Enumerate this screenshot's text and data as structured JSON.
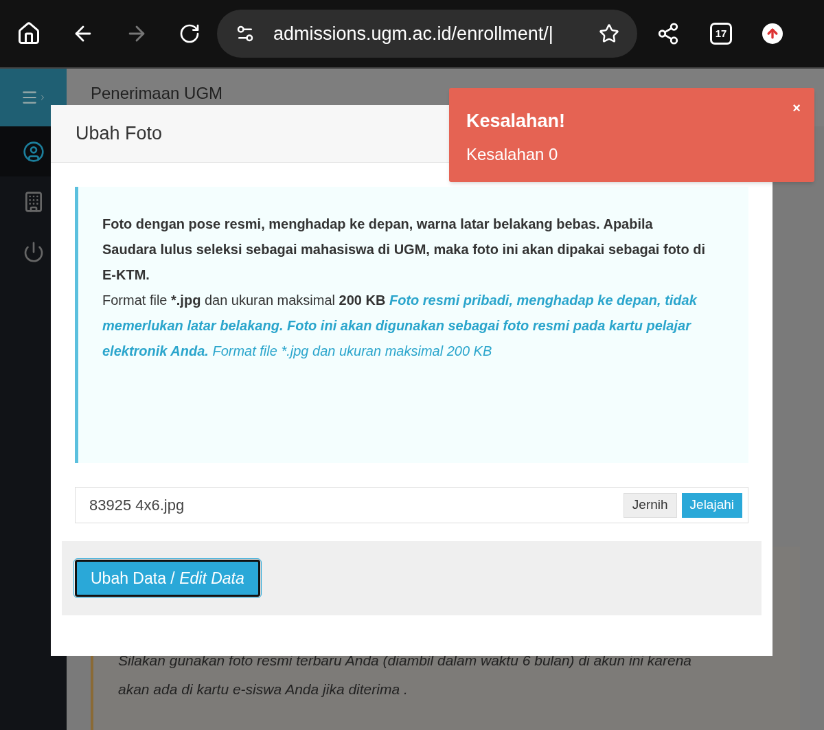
{
  "browser": {
    "url": "admissions.ugm.ac.id/enrollment/|",
    "tab_count": "17"
  },
  "page": {
    "header": "Penerimaan UGM",
    "background_lines": [
      "Silakan gunakan foto resmi terbaru Anda (diambil dalam waktu 6 bulan) di akun ini karena",
      "akan ada di kartu e-siswa Anda jika diterima ."
    ]
  },
  "sidebar": {
    "items": [
      {
        "kind": "user",
        "selected": true
      },
      {
        "kind": "building",
        "selected": false
      },
      {
        "kind": "power",
        "selected": false
      }
    ]
  },
  "modal": {
    "title": "Ubah Foto",
    "intro": "Foto dengan pose resmi, menghadap ke depan, warna latar belakang bebas. Apabila Saudara lulus seleksi sebagai mahasiswa di UGM, maka foto ini akan dipakai sebagai foto di E-KTM.",
    "details": [
      {
        "text": "Format file ",
        "kind": "plain"
      },
      {
        "text": "*.jpg",
        "kind": "strong"
      },
      {
        "text": " dan ukuran maksimal ",
        "kind": "plain"
      },
      {
        "text": "200 KB",
        "kind": "strong"
      },
      {
        "text": " Foto resmi pribadi, menghadap ke depan, tidak memerlukan latar belakang. Foto ini akan digunakan sebagai foto resmi pada kartu pelajar elektronik Anda.",
        "kind": "accent_strong"
      },
      {
        "text": " Format file *.jpg dan ukuran maksimal 200 KB",
        "kind": "accent"
      }
    ],
    "file_value": "83925 4x6.jpg",
    "clear_button": "Jernih",
    "browse_button": "Jelajahi",
    "submit": {
      "label": "Ubah Data /",
      "label_italic": "Edit Data"
    }
  },
  "toast": {
    "title": "Kesalahan!",
    "message": "Kesalahan 0",
    "close": "×"
  }
}
